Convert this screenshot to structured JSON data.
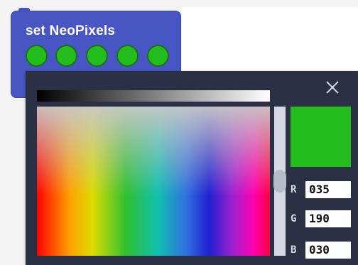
{
  "block": {
    "title": "set NeoPixels",
    "color": "#4856c4",
    "pixels": [
      {
        "color": "#23be1e"
      },
      {
        "color": "#23be1e"
      },
      {
        "color": "#23be1e"
      },
      {
        "color": "#23be1e"
      },
      {
        "color": "#23be1e"
      }
    ]
  },
  "color_picker": {
    "close_icon": "close-icon",
    "selected_color": "#23be1e",
    "rgb": [
      {
        "letter": "R",
        "value": "035"
      },
      {
        "letter": "G",
        "value": "190"
      },
      {
        "letter": "B",
        "value": "030"
      }
    ]
  }
}
